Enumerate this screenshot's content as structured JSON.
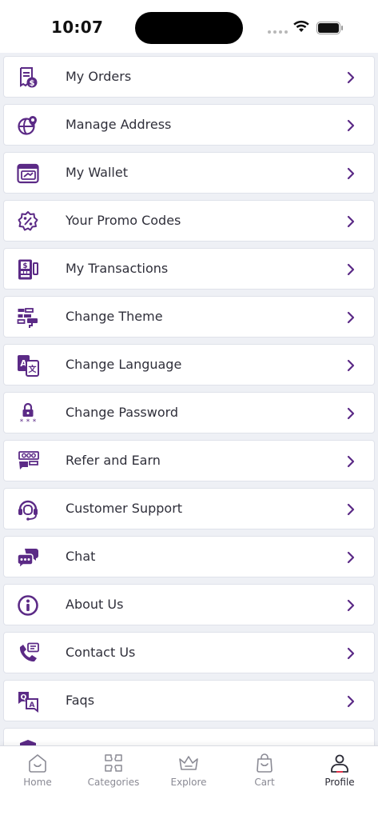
{
  "status_bar": {
    "time": "10:07"
  },
  "theme": {
    "accent": "#5b2a86",
    "icon_muted": "#8a8a94",
    "background": "#eef0f5"
  },
  "menu": {
    "items": [
      {
        "label": "My Orders",
        "icon": "receipt-dollar-icon"
      },
      {
        "label": "Manage Address",
        "icon": "globe-pin-icon"
      },
      {
        "label": "My Wallet",
        "icon": "wallet-icon"
      },
      {
        "label": "Your Promo Codes",
        "icon": "promo-badge-icon"
      },
      {
        "label": "My Transactions",
        "icon": "transactions-icon"
      },
      {
        "label": "Change Theme",
        "icon": "paint-roller-icon"
      },
      {
        "label": "Change Language",
        "icon": "translate-icon"
      },
      {
        "label": "Change Password",
        "icon": "lock-password-icon"
      },
      {
        "label": "Refer and Earn",
        "icon": "refer-megaphone-icon"
      },
      {
        "label": "Customer Support",
        "icon": "headset-icon"
      },
      {
        "label": "Chat",
        "icon": "chat-bubbles-icon"
      },
      {
        "label": "About Us",
        "icon": "info-icon"
      },
      {
        "label": "Contact Us",
        "icon": "phone-message-icon"
      },
      {
        "label": "Faqs",
        "icon": "qa-icon"
      }
    ]
  },
  "bottom_nav": {
    "items": [
      {
        "label": "Home",
        "icon": "home-icon",
        "active": false
      },
      {
        "label": "Categories",
        "icon": "categories-icon",
        "active": false
      },
      {
        "label": "Explore",
        "icon": "crown-icon",
        "active": false
      },
      {
        "label": "Cart",
        "icon": "bag-icon",
        "active": false
      },
      {
        "label": "Profile",
        "icon": "profile-icon",
        "active": true
      }
    ]
  }
}
